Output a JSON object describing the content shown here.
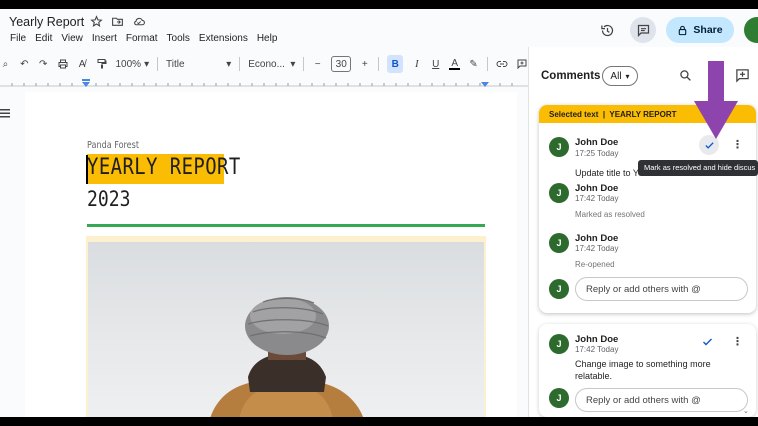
{
  "app": {
    "doc_title": "Yearly Report",
    "menu": [
      "File",
      "Edit",
      "View",
      "Insert",
      "Format",
      "Tools",
      "Extensions",
      "Help"
    ],
    "share_label": "Share"
  },
  "toolbar": {
    "zoom": "100%",
    "style": "Title",
    "font": "Econo...",
    "font_size": "30"
  },
  "document": {
    "company": "Panda Forest",
    "heading": "YEARLY REPORT",
    "year": "2023"
  },
  "comments": {
    "title": "Comments",
    "filter": "All",
    "tooltip": "Mark as resolved and hide discus",
    "thread1": {
      "selected_label": "Selected text",
      "selected_text": "YEARLY REPORT",
      "entries": [
        {
          "initial": "J",
          "author": "John Doe",
          "time": "17:25 Today",
          "text": "Update title to Y",
          "status": ""
        },
        {
          "initial": "J",
          "author": "John Doe",
          "time": "17:42 Today",
          "text": "",
          "status": "Marked as resolved"
        },
        {
          "initial": "J",
          "author": "John Doe",
          "time": "17:42 Today",
          "text": "",
          "status": "Re-opened"
        }
      ],
      "reply_placeholder": "Reply or add others with @"
    },
    "thread2": {
      "initial": "J",
      "author": "John Doe",
      "time": "17:42 Today",
      "text_line1": "Change image to something more",
      "text_line2": "relatable.",
      "reply_placeholder": "Reply or add others with @"
    }
  },
  "colors": {
    "highlight": "#fbbc04",
    "share_bg": "#c2e7ff",
    "annotation_arrow": "#8e44ad",
    "avatar": "#2d6a2e",
    "accent_line": "#34a853"
  }
}
